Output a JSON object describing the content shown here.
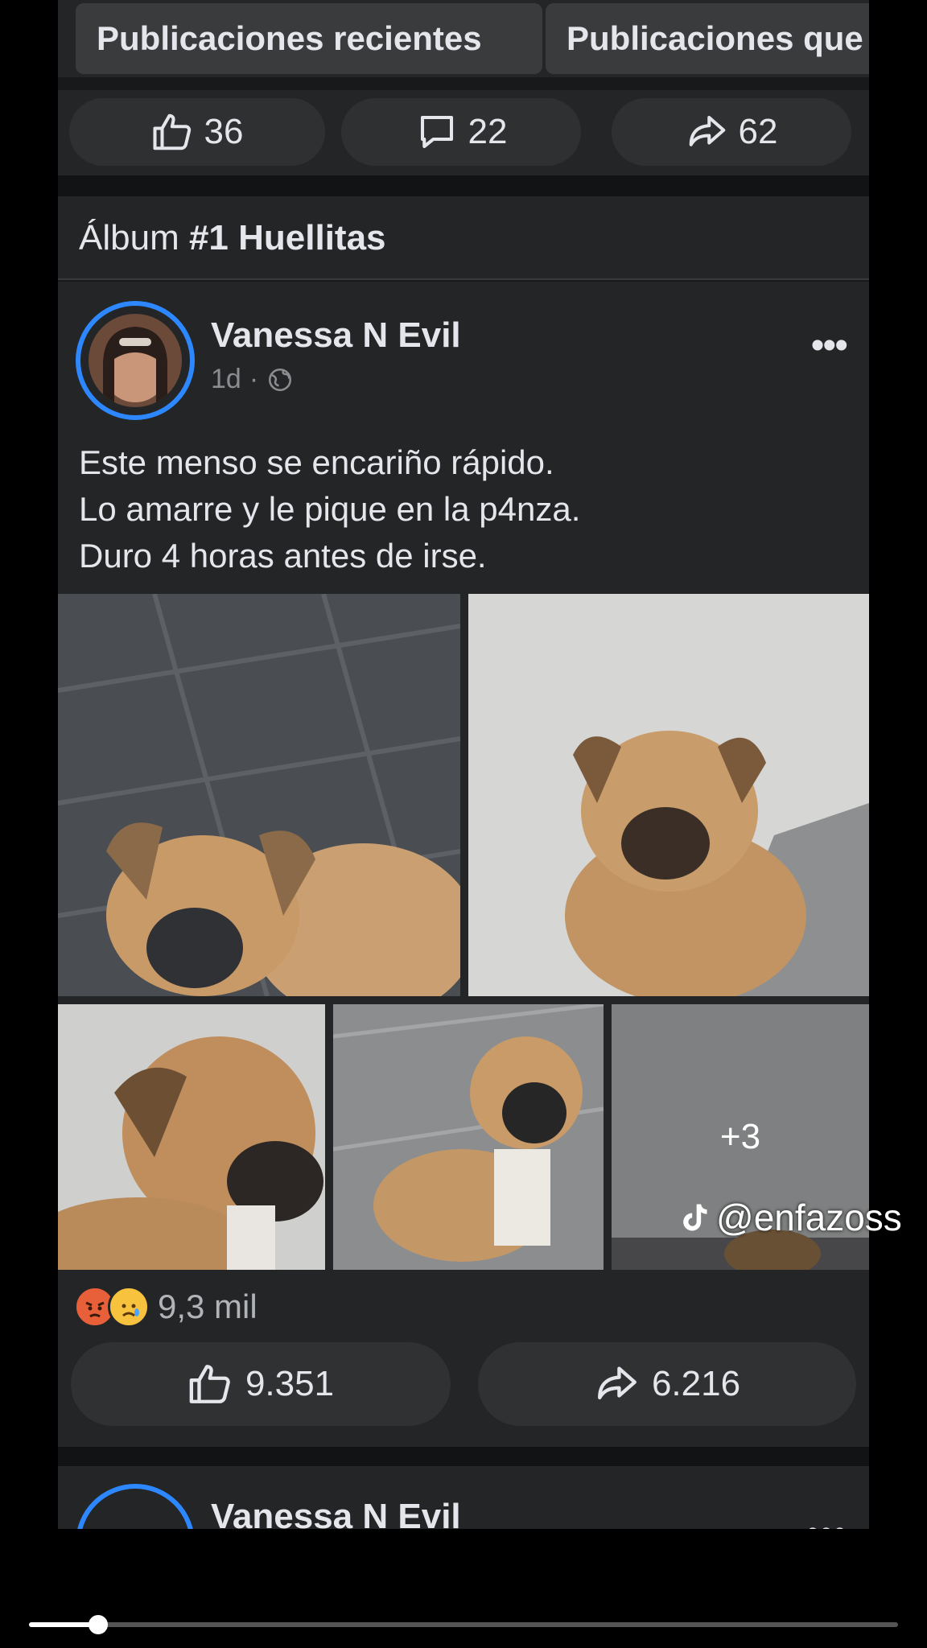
{
  "tabs": [
    "Publicaciones recientes",
    "Publicaciones que"
  ],
  "previous_post": {
    "likes": "36",
    "comments": "22",
    "shares": "62"
  },
  "album": {
    "prefix": "Álbum",
    "title": "#1 Huellitas"
  },
  "post": {
    "author": "Vanessa N Evil",
    "time": "1d",
    "separator": "·",
    "privacy_icon": "globe-icon",
    "caption_lines": [
      "Este menso se encariño rápido.",
      "Lo amarre y le pique en la p4nza.",
      "Duro 4 horas antes de irse."
    ],
    "extra_photos": "+3",
    "reaction_icons": [
      "angry-emoji",
      "sad-emoji"
    ],
    "reaction_count": "9,3 mil",
    "likes": "9.351",
    "shares": "6.216"
  },
  "next_post": {
    "author": "Vanessa N Evil"
  },
  "watermark": {
    "handle": "@enfazoss",
    "icon": "tiktok-icon"
  },
  "video_progress": 0.08,
  "colors": {
    "background": "#18191a",
    "card": "#242526",
    "accent": "#2d88ff",
    "text": "#e4e6eb",
    "muted": "#8a8d91"
  }
}
